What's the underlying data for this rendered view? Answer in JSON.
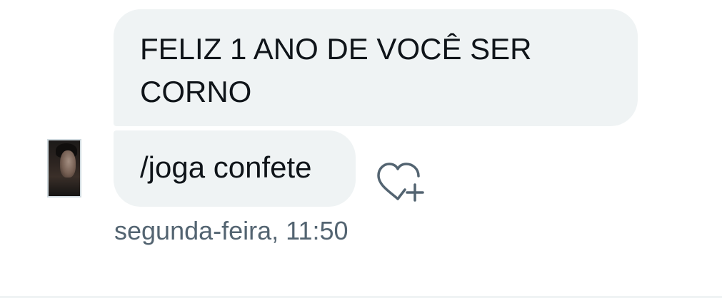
{
  "conversation": {
    "messages": [
      {
        "text": "FELIZ 1 ANO DE VOCÊ SER CORNO"
      },
      {
        "text": "/joga confete"
      }
    ],
    "timestamp": "segunda-feira, 11:50",
    "reaction_icon": "heart-plus-icon",
    "avatar_icon": "user-avatar"
  },
  "colors": {
    "bubble_background": "#eff3f4",
    "text_primary": "#0f1419",
    "text_secondary": "#536471"
  }
}
